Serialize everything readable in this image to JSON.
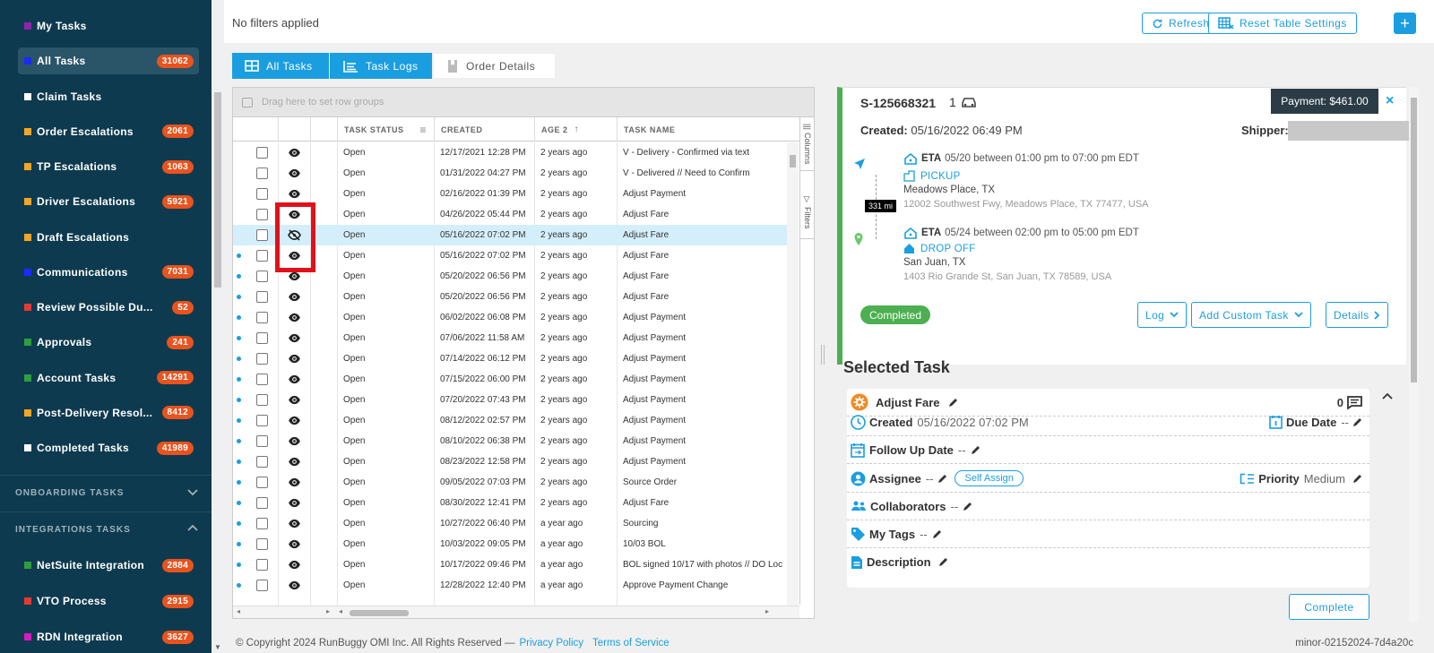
{
  "sidebar": {
    "items": [
      {
        "label": "My Tasks",
        "badge": "",
        "color": "#8e24aa"
      },
      {
        "label": "All Tasks",
        "badge": "31062",
        "color": "#1a2bff"
      },
      {
        "label": "Claim Tasks",
        "badge": "",
        "color": "#ffffff"
      },
      {
        "label": "Order Escalations",
        "badge": "2061",
        "color": "#f5a623"
      },
      {
        "label": "TP Escalations",
        "badge": "1063",
        "color": "#f5a623"
      },
      {
        "label": "Driver Escalations",
        "badge": "5921",
        "color": "#f5a623"
      },
      {
        "label": "Draft Escalations",
        "badge": "",
        "color": "#f5a623"
      },
      {
        "label": "Communications",
        "badge": "7031",
        "color": "#1a2bff"
      },
      {
        "label": "Review Possible Du...",
        "badge": "52",
        "color": "#e53935"
      },
      {
        "label": "Approvals",
        "badge": "241",
        "color": "#2e9e3e"
      },
      {
        "label": "Account Tasks",
        "badge": "14291",
        "color": "#2e9e3e"
      },
      {
        "label": "Post-Delivery Resol...",
        "badge": "8412",
        "color": "#f5a623"
      },
      {
        "label": "Completed Tasks",
        "badge": "41989",
        "color": "#ffffff"
      }
    ],
    "section_onboarding": "ONBOARDING TASKS",
    "section_integrations": "INTEGRATIONS TASKS",
    "integrations": [
      {
        "label": "NetSuite Integration",
        "badge": "2884",
        "color": "#2e9e3e"
      },
      {
        "label": "VTO Process",
        "badge": "2915",
        "color": "#e53935"
      },
      {
        "label": "RDN Integration",
        "badge": "3627",
        "color": "#d81bbf"
      }
    ]
  },
  "topbar": {
    "filters": "No filters applied",
    "refresh": "Refresh",
    "reset": "Reset Table Settings",
    "plus": "+"
  },
  "tabs": {
    "all_tasks": "All Tasks",
    "task_logs": "Task Logs",
    "order_details": "Order Details"
  },
  "grid": {
    "drag_hint": "Drag here to set row groups",
    "headers": {
      "status": "TASK STATUS",
      "created": "CREATED",
      "age": "AGE 2",
      "name": "TASK NAME"
    },
    "side_columns": "Columns",
    "side_filters": "Filters",
    "rows": [
      {
        "dot": false,
        "eye": "open",
        "status": "Open",
        "created": "12/17/2021 12:28 PM",
        "age": "2 years ago",
        "name": "V - Delivery - Confirmed via text"
      },
      {
        "dot": false,
        "eye": "open",
        "status": "Open",
        "created": "01/31/2022 04:27 PM",
        "age": "2 years ago",
        "name": "V - Delivered // Need to Confirm"
      },
      {
        "dot": false,
        "eye": "open",
        "status": "Open",
        "created": "02/16/2022 01:39 PM",
        "age": "2 years ago",
        "name": "Adjust Payment"
      },
      {
        "dot": false,
        "eye": "open",
        "status": "Open",
        "created": "04/26/2022 05:44 PM",
        "age": "2 years ago",
        "name": "Adjust Fare"
      },
      {
        "dot": false,
        "eye": "off",
        "status": "Open",
        "created": "05/16/2022 07:02 PM",
        "age": "2 years ago",
        "name": "Adjust Fare"
      },
      {
        "dot": true,
        "eye": "open",
        "status": "Open",
        "created": "05/16/2022 07:02 PM",
        "age": "2 years ago",
        "name": "Adjust Fare"
      },
      {
        "dot": true,
        "eye": "open",
        "status": "Open",
        "created": "05/20/2022 06:56 PM",
        "age": "2 years ago",
        "name": "Adjust Fare"
      },
      {
        "dot": true,
        "eye": "open",
        "status": "Open",
        "created": "05/20/2022 06:56 PM",
        "age": "2 years ago",
        "name": "Adjust Fare"
      },
      {
        "dot": true,
        "eye": "open",
        "status": "Open",
        "created": "06/02/2022 06:08 PM",
        "age": "2 years ago",
        "name": "Adjust Payment"
      },
      {
        "dot": true,
        "eye": "open",
        "status": "Open",
        "created": "07/06/2022 11:58 AM",
        "age": "2 years ago",
        "name": "Adjust Payment"
      },
      {
        "dot": true,
        "eye": "open",
        "status": "Open",
        "created": "07/14/2022 06:12 PM",
        "age": "2 years ago",
        "name": "Adjust Payment"
      },
      {
        "dot": true,
        "eye": "open",
        "status": "Open",
        "created": "07/15/2022 06:00 PM",
        "age": "2 years ago",
        "name": "Adjust Payment"
      },
      {
        "dot": true,
        "eye": "open",
        "status": "Open",
        "created": "07/20/2022 07:43 PM",
        "age": "2 years ago",
        "name": "Adjust Payment"
      },
      {
        "dot": true,
        "eye": "open",
        "status": "Open",
        "created": "08/12/2022 02:57 PM",
        "age": "2 years ago",
        "name": "Adjust Payment"
      },
      {
        "dot": true,
        "eye": "open",
        "status": "Open",
        "created": "08/10/2022 06:38 PM",
        "age": "2 years ago",
        "name": "Adjust Payment"
      },
      {
        "dot": true,
        "eye": "open",
        "status": "Open",
        "created": "08/23/2022 12:58 PM",
        "age": "2 years ago",
        "name": "Adjust Payment"
      },
      {
        "dot": true,
        "eye": "open",
        "status": "Open",
        "created": "09/05/2022 07:03 PM",
        "age": "2 years ago",
        "name": "Source Order"
      },
      {
        "dot": true,
        "eye": "open",
        "status": "Open",
        "created": "08/30/2022 12:41 PM",
        "age": "2 years ago",
        "name": "Adjust Fare"
      },
      {
        "dot": true,
        "eye": "open",
        "status": "Open",
        "created": "10/27/2022 06:40 PM",
        "age": "a year ago",
        "name": "Sourcing"
      },
      {
        "dot": true,
        "eye": "open",
        "status": "Open",
        "created": "10/03/2022 09:05 PM",
        "age": "a year ago",
        "name": "10/03 BOL"
      },
      {
        "dot": true,
        "eye": "open",
        "status": "Open",
        "created": "10/17/2022 09:46 PM",
        "age": "a year ago",
        "name": "BOL signed 10/17 with photos // DO Loc"
      },
      {
        "dot": true,
        "eye": "open",
        "status": "Open",
        "created": "12/28/2022 12:40 PM",
        "age": "a year ago",
        "name": "Approve Payment Change"
      }
    ]
  },
  "order": {
    "id": "S-125668321",
    "qty": "1",
    "payment": "Payment: $461.00",
    "close": "×",
    "created_label": "Created:",
    "created_value": "05/16/2022 06:49 PM",
    "shipper_label": "Shipper:",
    "distance": "331 mi",
    "pickup": {
      "eta_label": "ETA",
      "eta": "05/20 between 01:00 pm to 07:00 pm EDT",
      "type": "PICKUP",
      "city": "Meadows Place, TX",
      "address": "12002 Southwest Fwy, Meadows Place, TX 77477, USA"
    },
    "dropoff": {
      "eta_label": "ETA",
      "eta": "05/24 between 02:00 pm to 05:00 pm EDT",
      "type": "DROP OFF",
      "city": "San Juan, TX",
      "address": "1403 Rio Grande St, San Juan, TX 78589, USA"
    },
    "status": "Completed",
    "log_btn": "Log",
    "custom_task_btn": "Add Custom Task",
    "details_btn": "Details"
  },
  "selected_task": {
    "heading": "Selected Task",
    "name": "Adjust Fare",
    "comments": "0",
    "created_label": "Created",
    "created_value": "05/16/2022 07:02 PM",
    "due_label": "Due Date",
    "due_value": "--",
    "followup_label": "Follow Up Date",
    "followup_value": "--",
    "assignee_label": "Assignee",
    "assignee_value": "--",
    "self_assign": "Self Assign",
    "priority_label": "Priority",
    "priority_value": "Medium",
    "collaborators_label": "Collaborators",
    "collaborators_value": "--",
    "tags_label": "My Tags",
    "tags_value": "--",
    "description_label": "Description",
    "complete_btn": "Complete"
  },
  "footer": {
    "copyright": "© Copyright 2024 RunBuggy OMI Inc. All Rights Reserved —",
    "privacy": "Privacy Policy",
    "terms": "Terms of Service",
    "version": "minor-02152024-7d4a20c"
  },
  "colors": {
    "accent": "#1a9ee0",
    "sidebar": "#0e3a4f",
    "badge": "#e8531e",
    "success": "#4caf50",
    "highlight": "#e0111b"
  }
}
